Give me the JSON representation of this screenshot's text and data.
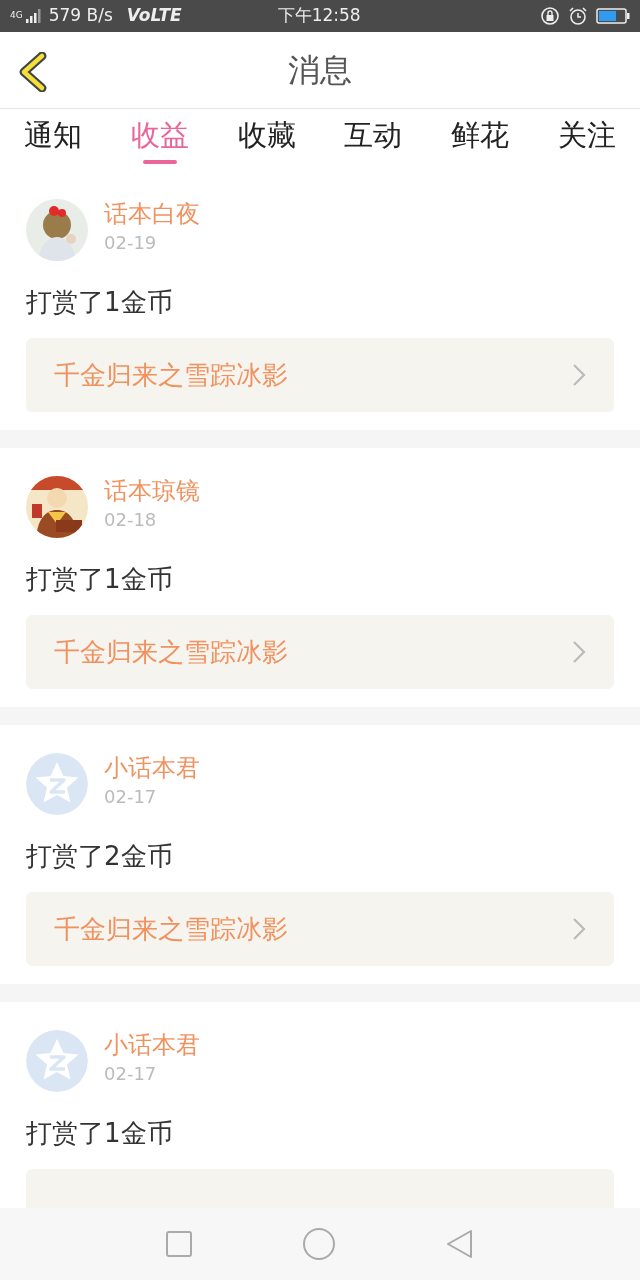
{
  "status_bar": {
    "network": "4G",
    "speed": "579 B/s",
    "volte": "VoLTE",
    "time": "下午12:58"
  },
  "header": {
    "title": "消息"
  },
  "tabs": [
    {
      "label": "通知",
      "selected": false
    },
    {
      "label": "收益",
      "selected": true
    },
    {
      "label": "收藏",
      "selected": false
    },
    {
      "label": "互动",
      "selected": false
    },
    {
      "label": "鲜花",
      "selected": false
    },
    {
      "label": "关注",
      "selected": false
    }
  ],
  "messages": [
    {
      "name": "话本白夜",
      "date": "02-19",
      "text": "打赏了1金币",
      "book": "千金归来之雪踪冰影"
    },
    {
      "name": "话本琼镜",
      "date": "02-18",
      "text": "打赏了1金币",
      "book": "千金归来之雪踪冰影"
    },
    {
      "avatar": {
        "kind": "default"
      },
      "name": "小话本君",
      "date": "02-17",
      "text": "打赏了2金币",
      "book": "千金归来之雪踪冰影"
    },
    {
      "avatar": {
        "kind": "default"
      },
      "name": "小话本君",
      "date": "02-17",
      "text": "打赏了1金币"
    }
  ]
}
